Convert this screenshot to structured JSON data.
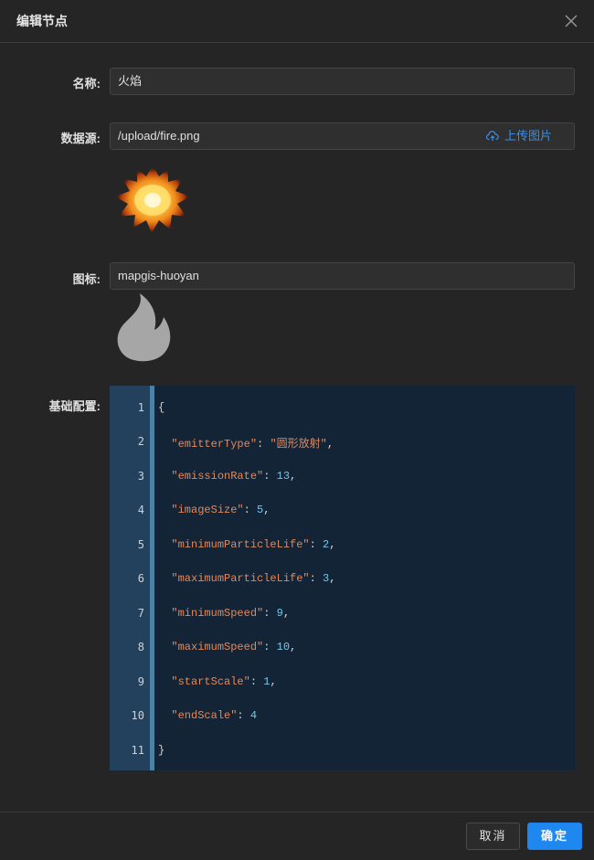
{
  "dialog": {
    "title": "编辑节点"
  },
  "form": {
    "name": {
      "label": "名称:",
      "value": "火焰"
    },
    "datasource": {
      "label": "数据源:",
      "value": "/upload/fire.png",
      "upload_label": "上传图片"
    },
    "icon": {
      "label": "图标:",
      "value": "mapgis-huoyan"
    },
    "config": {
      "label": "基础配置:"
    }
  },
  "code": {
    "line_numbers": [
      "1",
      "2",
      "3",
      "4",
      "5",
      "6",
      "7",
      "8",
      "9",
      "10",
      "11"
    ],
    "open": "{",
    "close": "}",
    "entries": [
      {
        "key": "\"emitterType\"",
        "value": "\"圆形放射\"",
        "sep": ","
      },
      {
        "key": "\"emissionRate\"",
        "value": "13",
        "sep": ","
      },
      {
        "key": "\"imageSize\"",
        "value": "5",
        "sep": ","
      },
      {
        "key": "\"minimumParticleLife\"",
        "value": "2",
        "sep": ","
      },
      {
        "key": "\"maximumParticleLife\"",
        "value": "3",
        "sep": ","
      },
      {
        "key": "\"minimumSpeed\"",
        "value": "9",
        "sep": ","
      },
      {
        "key": "\"maximumSpeed\"",
        "value": "10",
        "sep": ","
      },
      {
        "key": "\"startScale\"",
        "value": "1",
        "sep": ","
      },
      {
        "key": "\"endScale\"",
        "value": "4",
        "sep": ""
      }
    ]
  },
  "footer": {
    "cancel_label": "取消",
    "ok_label": "确定"
  },
  "colors": {
    "accent": "#1e88f0",
    "code_bg": "#132436",
    "string": "#e0895e",
    "number": "#79c4e8"
  },
  "icons": [
    "close-icon",
    "cloud-upload-icon",
    "fire-image",
    "flame-icon"
  ]
}
